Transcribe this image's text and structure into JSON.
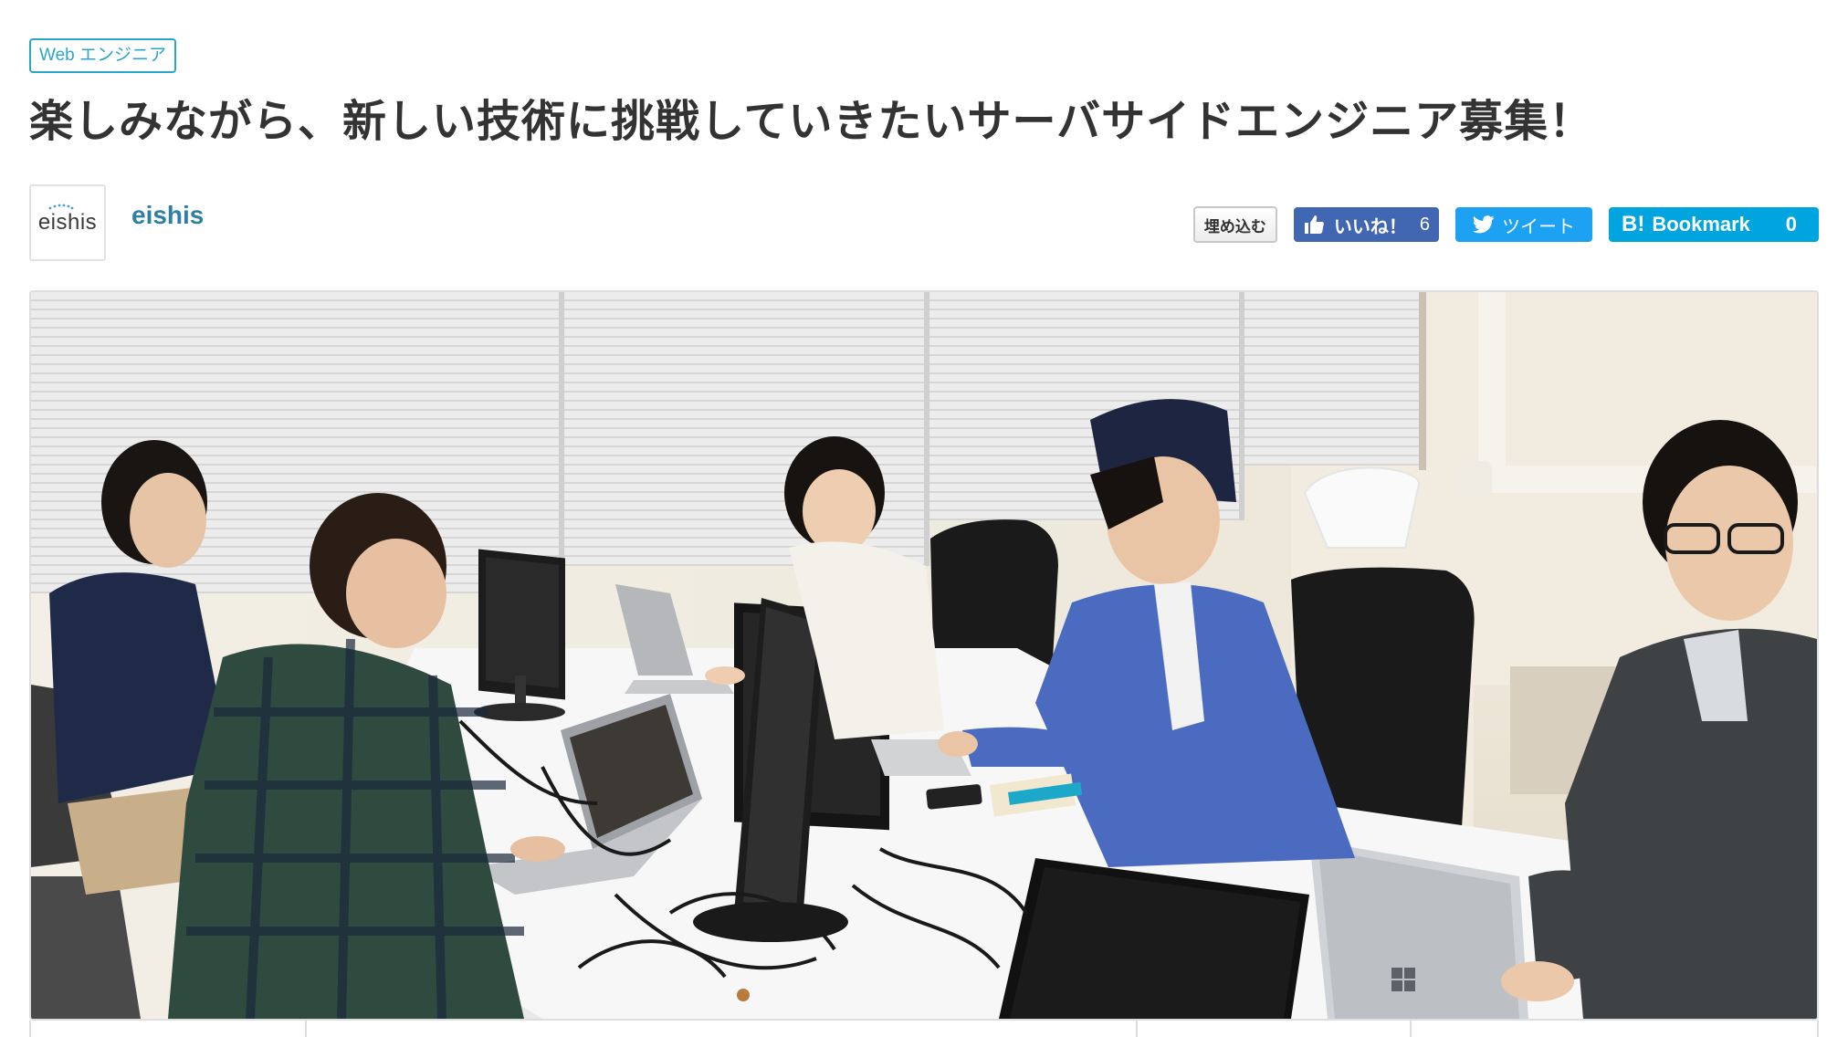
{
  "category_tag": "Web エンジニア",
  "title": "楽しみながら、新しい技術に挑戦していきたいサーバサイドエンジニア募集！",
  "company": {
    "logo_text": "eishis",
    "name": "eishis"
  },
  "actions": {
    "embed_label": "埋め込む",
    "like_label": "いいね！",
    "like_count": "6",
    "tweet_label": "ツイート",
    "bookmark_mark": "B!",
    "bookmark_label": "Bookmark",
    "bookmark_count": "0"
  },
  "colors": {
    "tag_border": "#2ba6cb",
    "company_name": "#2d7fa6",
    "facebook": "#4267b2",
    "twitter": "#1da1f2",
    "hatena": "#00a4de"
  },
  "icons": {
    "like": "thumbs-up-icon",
    "tweet": "twitter-bird-icon"
  }
}
